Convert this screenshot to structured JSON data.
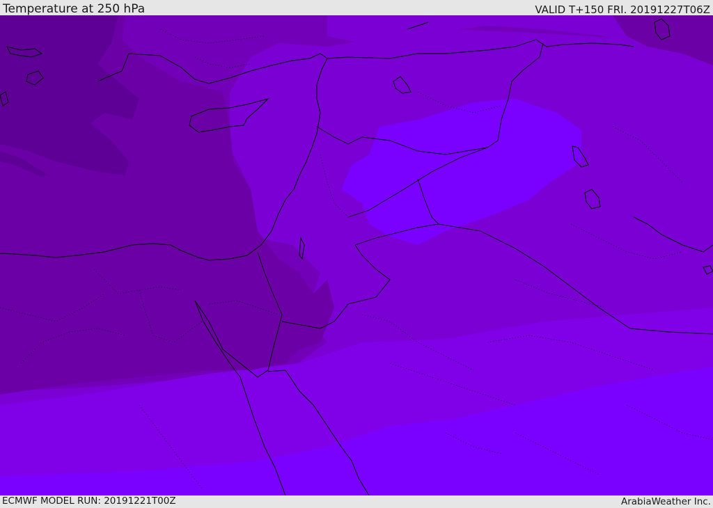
{
  "header": {
    "title": "Temperature at 250 hPa",
    "valid": "VALID T+150 FRI. 20191227T06Z"
  },
  "footer": {
    "model_run": "ECMWF MODEL RUN: 20191221T00Z",
    "credit": "ArabiaWeather Inc."
  },
  "map": {
    "field": "temperature",
    "level": "250 hPa",
    "region": "Eastern Mediterranean / Middle East",
    "colors": {
      "darkest": "#5e0096",
      "dark": "#6a00a6",
      "mid": "#7300b9",
      "mid_light": "#7a00d4",
      "light": "#8000e8",
      "lightest": "#7a00ff",
      "coastline": "#000000"
    },
    "overlays": [
      "coastlines",
      "country-borders",
      "province-borders"
    ]
  }
}
